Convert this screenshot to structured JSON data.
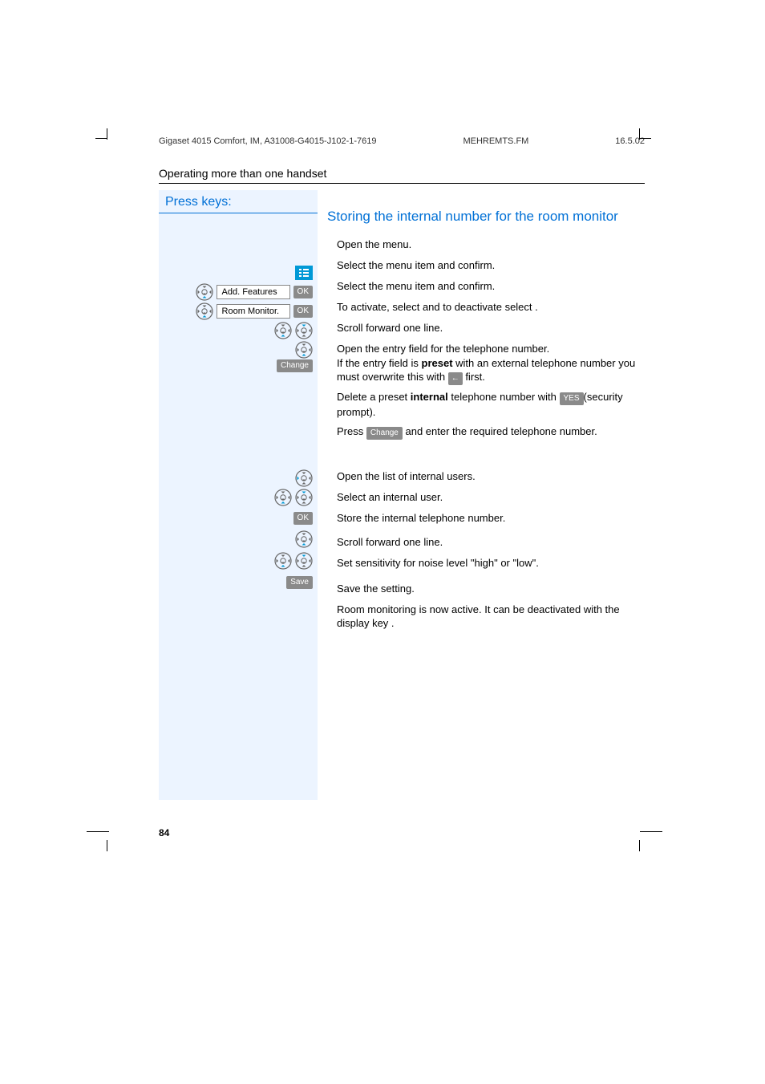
{
  "header": {
    "left": "Gigaset 4015 Comfort, IM, A31008-G4015-J102-1-7619",
    "center": "MEHREMTS.FM",
    "right": "16.5.02"
  },
  "section_title": "Operating more than one handset",
  "press_keys": "Press keys:",
  "subtitle": "Storing the internal number for the room monitor",
  "left": {
    "item1": "Add. Features",
    "item2": "Room Monitor.",
    "ok": "OK",
    "change": "Change",
    "save": "Save"
  },
  "right": {
    "l1": "Open the menu.",
    "l2": "Select the menu item and confirm.",
    "l3": "Select the menu item and confirm.",
    "l4": "To activate, select and to deactivate select .",
    "l5": "Scroll forward one line.",
    "l6a": "Open the entry field for the telephone number.",
    "l6b_pre": "If the entry field is ",
    "l6b_bold": "preset",
    "l6b_post": " with an external telephone number you must overwrite this with ",
    "l6b_end": " first.",
    "l7_pre": "Delete a preset ",
    "l7_bold": "internal",
    "l7_post": " telephone number with ",
    "l7_yes": "YES",
    "l7_end": "(security prompt).",
    "l8_pre": "Press ",
    "l8_btn": "Change",
    "l8_post": " and enter the required telephone number.",
    "l9": "Open the list of internal users.",
    "l10": "Select an internal user.",
    "l11": "Store the internal telephone number.",
    "l12": "Scroll forward one line.",
    "l13": "Set sensitivity for noise level \"high\" or \"low\".",
    "l14": "Save the setting.",
    "l15": "Room monitoring is now active. It can be deactivated with the display key ."
  },
  "page_num": "84"
}
